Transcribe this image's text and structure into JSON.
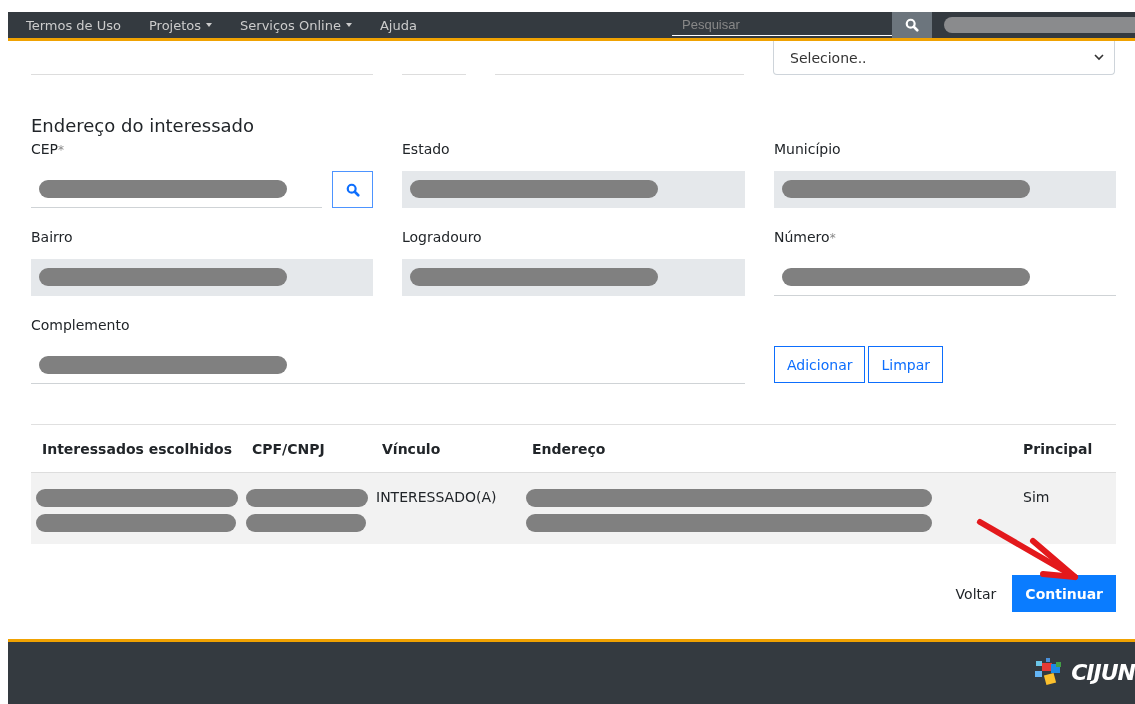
{
  "nav": {
    "links": [
      {
        "label": "Termos de Uso",
        "dropdown": false
      },
      {
        "label": "Projetos",
        "dropdown": true
      },
      {
        "label": "Serviços Online",
        "dropdown": true
      },
      {
        "label": "Ajuda",
        "dropdown": false
      }
    ],
    "search": {
      "placeholder": "Pesquisar"
    }
  },
  "previous_fields": {
    "select": {
      "value": "Selecione.."
    }
  },
  "address": {
    "title": "Endereço do interessado",
    "fields": [
      {
        "label": "CEP",
        "marker": "*",
        "kind": "lookup",
        "readonly": false
      },
      {
        "label": "Estado",
        "kind": "text",
        "readonly": true
      },
      {
        "label": "Município",
        "kind": "text",
        "readonly": true
      },
      {
        "label": "Bairro",
        "kind": "text",
        "readonly": true
      },
      {
        "label": "Logradouro",
        "kind": "text",
        "readonly": true
      },
      {
        "label": "Número",
        "marker": "*",
        "kind": "text",
        "readonly": false
      },
      {
        "label": "Complemento",
        "kind": "wide",
        "readonly": false
      }
    ],
    "buttons": [
      "Adicionar",
      "Limpar"
    ]
  },
  "table": {
    "columns": [
      "Interessados escolhidos",
      "CPF/CNPJ",
      "Vínculo",
      "Endereço",
      "Principal"
    ],
    "rows": [
      {
        "cells": [
          {
            "kind": "redacted"
          },
          {
            "kind": "redacted"
          },
          {
            "kind": "text",
            "text": "INTERESSADO(A)"
          },
          {
            "kind": "redacted"
          },
          {
            "kind": "text",
            "text": "Sim"
          }
        ]
      }
    ]
  },
  "actions": {
    "back": "Voltar",
    "next": "Continuar"
  },
  "footer": {
    "logo": "CIJUN"
  }
}
